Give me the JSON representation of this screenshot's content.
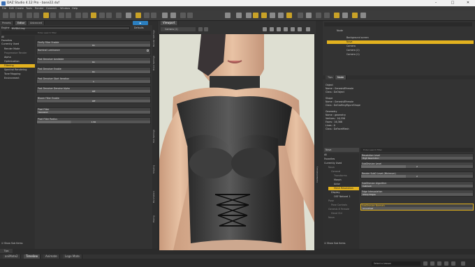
{
  "window": {
    "title": "DAZ Studio 4.12 Pro - base22.duf"
  },
  "menu": [
    "File",
    "Edit",
    "Create",
    "Tools",
    "Render",
    "Connect",
    "Window",
    "Help"
  ],
  "left_panel": {
    "tabs": [
      "Presets",
      "Editor",
      "Advanced"
    ],
    "engine_label": "Engine",
    "engine_value": "NVIDIA Iray",
    "defaults_label": "Defaults",
    "search_placeholder": "Enter search filter",
    "categories": [
      "All",
      "Favorites",
      "Currently Used",
      "Render Mode",
      "Progressive Render",
      "Alpha",
      "Optimization",
      "Filtering",
      "Spectral Rendering",
      "Tone Mapping",
      "Environment"
    ],
    "selected_category": "Filtering",
    "properties": [
      {
        "label": "Firefly Filter Enable",
        "value": "On"
      },
      {
        "label": "Nominal Luminance",
        "value": ""
      },
      {
        "label": "Post Denoiser Available",
        "value": "On"
      },
      {
        "label": "Post Denoiser Enable",
        "value": "On"
      },
      {
        "label": "Post Denoiser Start Iteration",
        "value": "1"
      },
      {
        "label": "Post Denoiser Denoise Alpha",
        "value": "Off"
      },
      {
        "label": "Bloom Filter Enable",
        "value": "Off"
      },
      {
        "label": "Pixel Filter",
        "value": "Gaussian"
      },
      {
        "label": "Pixel Filter Radius",
        "value": "1.50"
      }
    ],
    "show_sub_items": "Show Sub Items",
    "tips_tab": "Tips"
  },
  "viewport": {
    "tab": "Viewport",
    "camera": "Camera (1)"
  },
  "center_vtabs": [
    "Render Settings",
    "Draw Settings",
    "Tool Settings",
    "Shaping",
    "Parameters",
    "Posing",
    "Content Library"
  ],
  "scene": {
    "header": "Node",
    "items": [
      {
        "name": "Background screen",
        "selected": false
      },
      {
        "name": "Nova",
        "selected": true
      },
      {
        "name": "Camera",
        "selected": false
      },
      {
        "name": "Camera (2)",
        "selected": false
      },
      {
        "name": "Camera (1)",
        "selected": false
      }
    ],
    "info_tabs": [
      "Tips",
      "Node"
    ],
    "info": [
      "Object",
      "Name : Genesis8Female",
      "Class : DzObject",
      "Shape",
      "Name : Genesis8Female",
      "Class : DzGraftingFigureShape",
      "Geometry",
      "Name : geometry",
      "Vertices : 16,556",
      "Faces : 16,368",
      "Lines : 0",
      "Class : DzFacetMesh"
    ]
  },
  "surfaces": {
    "dropdown": "Nova",
    "search_placeholder": "Enter search filter",
    "tree": [
      "All",
      "Favorites",
      "Currently Used",
      "Nova",
      "General",
      "Transforms",
      "Morph",
      "Actor",
      "Mesh Resolution",
      "Display",
      "OSF Natural 1",
      "Pose",
      "Pose Controls",
      "Genesis 8 Female",
      "Head Ctrl",
      "Nova"
    ],
    "selected_tree": "Mesh Resolution",
    "properties": [
      {
        "label": "Resolution Level",
        "value": "High Resolution"
      },
      {
        "label": "SubDivision Level",
        "value": "2"
      },
      {
        "label": "Render SubD Level (Minimum)",
        "value": "2"
      },
      {
        "label": "SubDivision Algorithm",
        "value": "Catmark"
      },
      {
        "label": "Edge Interpolation",
        "value": "Sharp Edges"
      },
      {
        "label": "SubDivision Normals",
        "value": "Smoothed"
      }
    ],
    "show_sub_items": "Show Sub Items"
  },
  "bottom_tabs": [
    "aniMate2",
    "Timeline",
    "Animate",
    "Logo Mate"
  ],
  "lesson_placeholder": "Select a Lesson"
}
